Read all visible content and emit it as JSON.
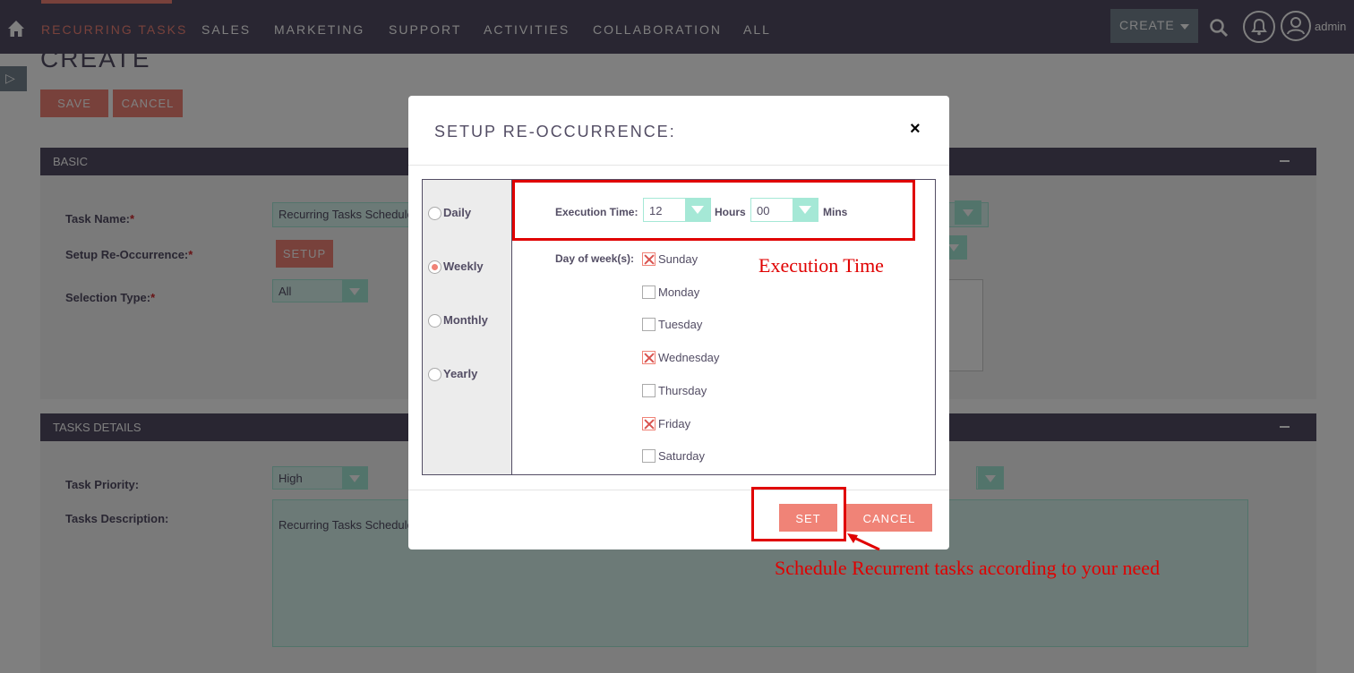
{
  "nav": {
    "items": [
      "Recurring Tasks",
      "Sales",
      "Marketing",
      "Support",
      "Activities",
      "Collaboration",
      "All"
    ],
    "create_label": "CREATE",
    "user_label": "admin"
  },
  "page": {
    "title": "CREATE",
    "save_label": "SAVE",
    "cancel_label": "CANCEL"
  },
  "basic_panel": {
    "header": "BASIC",
    "task_name_label": "Task Name:",
    "task_name_value": "Recurring Tasks Scheduler",
    "setup_label": "Setup Re-Occurrence:",
    "setup_button": "SETUP",
    "selection_type_label": "Selection Type:",
    "selection_type_value": "All"
  },
  "details_panel": {
    "header": "TASKS DETAILS",
    "priority_label": "Task Priority:",
    "priority_value": "High",
    "description_label": "Tasks Description:",
    "description_value": "Recurring Tasks Scheduler"
  },
  "modal": {
    "title": "SETUP RE-OCCURRENCE:",
    "close": "×",
    "frequencies": [
      {
        "label": "Daily",
        "selected": false
      },
      {
        "label": "Weekly",
        "selected": true
      },
      {
        "label": "Monthly",
        "selected": false
      },
      {
        "label": "Yearly",
        "selected": false
      }
    ],
    "execution_time_label": "Execution Time:",
    "hours_value": "12",
    "hours_unit": "Hours",
    "mins_value": "00",
    "mins_unit": "Mins",
    "day_of_week_label": "Day of week(s):",
    "days": [
      {
        "label": "Sunday",
        "checked": true
      },
      {
        "label": "Monday",
        "checked": false
      },
      {
        "label": "Tuesday",
        "checked": false
      },
      {
        "label": "Wednesday",
        "checked": true
      },
      {
        "label": "Thursday",
        "checked": false
      },
      {
        "label": "Friday",
        "checked": true
      },
      {
        "label": "Saturday",
        "checked": false
      }
    ],
    "set_label": "SET",
    "cancel_label": "CANCEL"
  },
  "annotations": {
    "execution_time": "Execution Time",
    "schedule_note": "Schedule Recurrent tasks according to your need"
  },
  "colors": {
    "header_bg": "#534d64",
    "accent": "#f08377",
    "select_teal": "#a5e8d6",
    "annotation_red": "#e00000"
  }
}
